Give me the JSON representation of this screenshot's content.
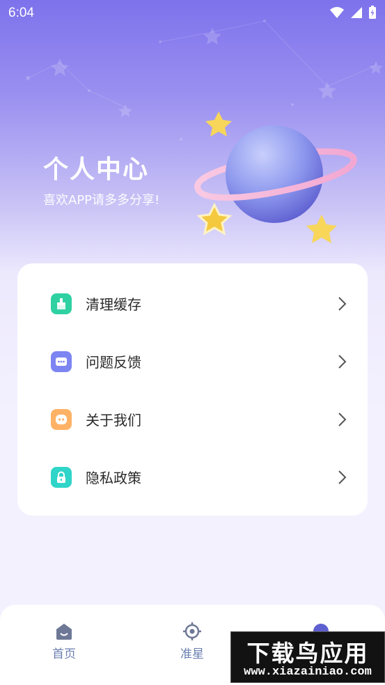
{
  "status_bar": {
    "time": "6:04"
  },
  "hero": {
    "title": "个人中心",
    "subtitle": "喜欢APP请多多分享!"
  },
  "menu": {
    "items": [
      {
        "label": "清理缓存",
        "icon": "broom-icon",
        "color": "#2fd0a2"
      },
      {
        "label": "问题反馈",
        "icon": "chat-dots-icon",
        "color": "#7d85f2"
      },
      {
        "label": "关于我们",
        "icon": "robot-face-icon",
        "color": "#ffb266"
      },
      {
        "label": "隐私政策",
        "icon": "lock-icon",
        "color": "#2fd5c8"
      }
    ]
  },
  "bottom_nav": {
    "items": [
      {
        "label": "首页",
        "icon": "home-icon"
      },
      {
        "label": "准星",
        "icon": "crosshair-icon"
      },
      {
        "label": "",
        "icon": "planet-icon",
        "active": true
      }
    ]
  },
  "watermark": {
    "title": "下载鸟应用",
    "url": "www.xiazainiao.com"
  },
  "colors": {
    "accent": "#7d72ec",
    "nav_text": "#6a7fb0"
  }
}
